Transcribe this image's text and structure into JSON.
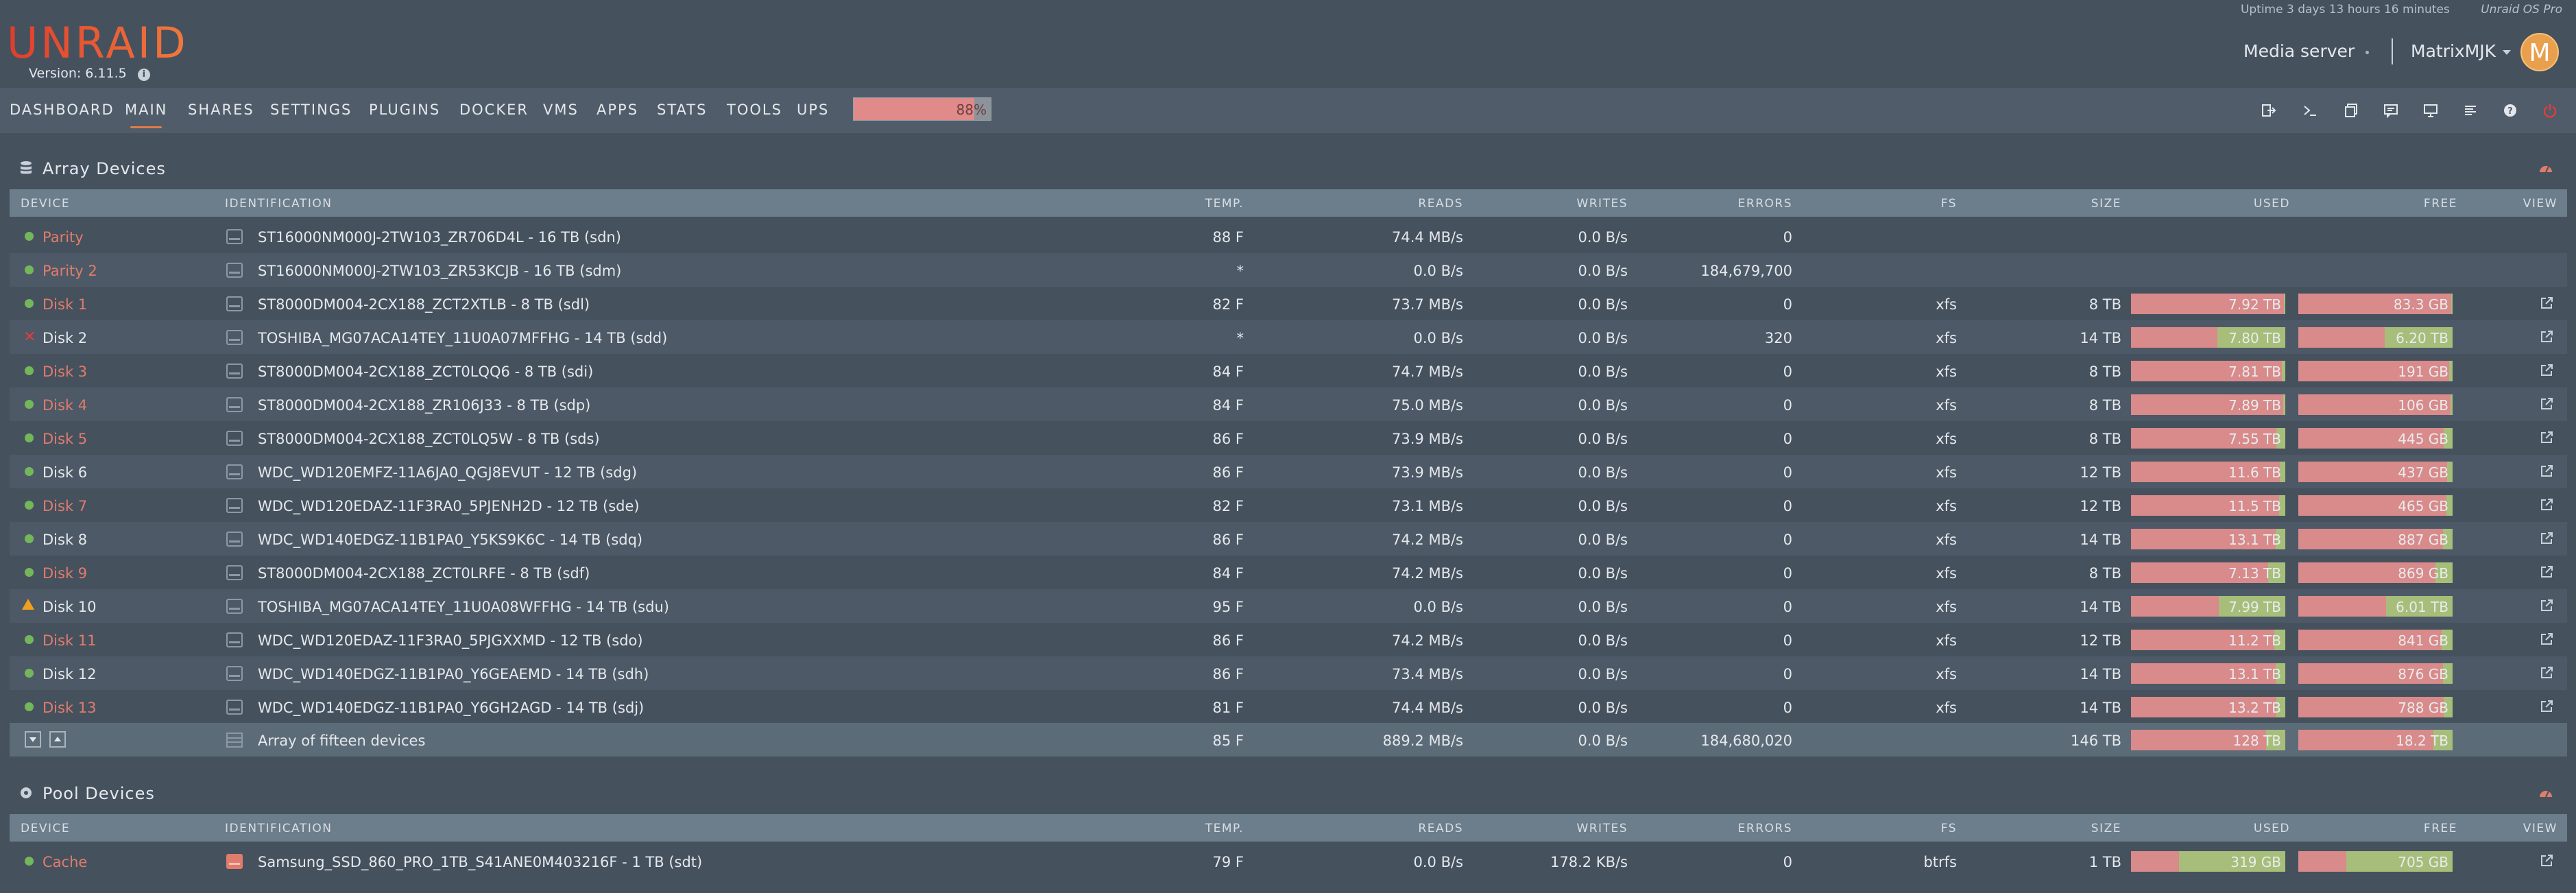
{
  "header": {
    "logo": "UNRAID",
    "version": "Version: 6.11.5",
    "uptime": "Uptime 3 days 13 hours 16 minutes",
    "os": "Unraid OS Pro",
    "server_name": "Media server",
    "user_name": "MatrixMJK",
    "avatar_letter": "M"
  },
  "nav": {
    "items": [
      "DASHBOARD",
      "MAIN",
      "SHARES",
      "SETTINGS",
      "PLUGINS",
      "DOCKER",
      "VMS",
      "APPS",
      "STATS",
      "TOOLS",
      "UPS"
    ],
    "active": "MAIN",
    "cpu_load_text": "88%",
    "cpu_load": 0.88,
    "toolbar_icons": [
      "logout-icon",
      "terminal-icon",
      "copy-icon",
      "feedback-icon",
      "monitor-icon",
      "log-icon",
      "help-icon",
      "power-icon"
    ]
  },
  "colors": {
    "accent": "#e07c48",
    "used": "#d98a8a",
    "free": "#a7be7a",
    "ok": "#73b75a",
    "error": "#e23c3c",
    "warn": "#f0a020"
  },
  "array": {
    "title": "Array Devices",
    "columns": [
      "DEVICE",
      "IDENTIFICATION",
      "TEMP.",
      "READS",
      "WRITES",
      "ERRORS",
      "FS",
      "SIZE",
      "USED",
      "FREE",
      "VIEW"
    ],
    "rows": [
      {
        "status": "ok",
        "device": "Parity",
        "color": "red",
        "ident": "ST16000NM000J-2TW103_ZR706D4L - 16 TB (sdn)",
        "temp": "88 F",
        "reads": "74.4 MB/s",
        "writes": "0.0 B/s",
        "errors": "0",
        "fs": "",
        "size": "",
        "used": "",
        "free": "",
        "used_frac": 0
      },
      {
        "status": "ok",
        "device": "Parity 2",
        "color": "red",
        "ident": "ST16000NM000J-2TW103_ZR53KCJB - 16 TB (sdm)",
        "temp": "*",
        "reads": "0.0 B/s",
        "writes": "0.0 B/s",
        "errors": "184,679,700",
        "fs": "",
        "size": "",
        "used": "",
        "free": "",
        "used_frac": 0
      },
      {
        "status": "ok",
        "device": "Disk 1",
        "color": "red",
        "ident": "ST8000DM004-2CX188_ZCT2XTLB - 8 TB (sdl)",
        "temp": "82 F",
        "reads": "73.7 MB/s",
        "writes": "0.0 B/s",
        "errors": "0",
        "fs": "xfs",
        "size": "8 TB",
        "used": "7.92 TB",
        "free": "83.3 GB",
        "used_frac": 0.99
      },
      {
        "status": "error",
        "device": "Disk 2",
        "color": "light",
        "ident": "TOSHIBA_MG07ACA14TEY_11U0A07MFFHG - 14 TB (sdd)",
        "temp": "*",
        "reads": "0.0 B/s",
        "writes": "0.0 B/s",
        "errors": "320",
        "fs": "xfs",
        "size": "14 TB",
        "used": "7.80 TB",
        "free": "6.20 TB",
        "used_frac": 0.56
      },
      {
        "status": "ok",
        "device": "Disk 3",
        "color": "red",
        "ident": "ST8000DM004-2CX188_ZCT0LQQ6 - 8 TB (sdi)",
        "temp": "84 F",
        "reads": "74.7 MB/s",
        "writes": "0.0 B/s",
        "errors": "0",
        "fs": "xfs",
        "size": "8 TB",
        "used": "7.81 TB",
        "free": "191 GB",
        "used_frac": 0.976
      },
      {
        "status": "ok",
        "device": "Disk 4",
        "color": "red",
        "ident": "ST8000DM004-2CX188_ZR106J33 - 8 TB (sdp)",
        "temp": "84 F",
        "reads": "75.0 MB/s",
        "writes": "0.0 B/s",
        "errors": "0",
        "fs": "xfs",
        "size": "8 TB",
        "used": "7.89 TB",
        "free": "106 GB",
        "used_frac": 0.987
      },
      {
        "status": "ok",
        "device": "Disk 5",
        "color": "red",
        "ident": "ST8000DM004-2CX188_ZCT0LQ5W - 8 TB (sds)",
        "temp": "86 F",
        "reads": "73.9 MB/s",
        "writes": "0.0 B/s",
        "errors": "0",
        "fs": "xfs",
        "size": "8 TB",
        "used": "7.55 TB",
        "free": "445 GB",
        "used_frac": 0.944
      },
      {
        "status": "ok",
        "device": "Disk 6",
        "color": "light",
        "ident": "WDC_WD120EMFZ-11A6JA0_QGJ8EVUT - 12 TB (sdg)",
        "temp": "86 F",
        "reads": "73.9 MB/s",
        "writes": "0.0 B/s",
        "errors": "0",
        "fs": "xfs",
        "size": "12 TB",
        "used": "11.6 TB",
        "free": "437 GB",
        "used_frac": 0.964
      },
      {
        "status": "ok",
        "device": "Disk 7",
        "color": "red",
        "ident": "WDC_WD120EDAZ-11F3RA0_5PJENH2D - 12 TB (sde)",
        "temp": "82 F",
        "reads": "73.1 MB/s",
        "writes": "0.0 B/s",
        "errors": "0",
        "fs": "xfs",
        "size": "12 TB",
        "used": "11.5 TB",
        "free": "465 GB",
        "used_frac": 0.961
      },
      {
        "status": "ok",
        "device": "Disk 8",
        "color": "light",
        "ident": "WDC_WD140EDGZ-11B1PA0_Y5KS9K6C - 14 TB (sdq)",
        "temp": "86 F",
        "reads": "74.2 MB/s",
        "writes": "0.0 B/s",
        "errors": "0",
        "fs": "xfs",
        "size": "14 TB",
        "used": "13.1 TB",
        "free": "887 GB",
        "used_frac": 0.937
      },
      {
        "status": "ok",
        "device": "Disk 9",
        "color": "red",
        "ident": "ST8000DM004-2CX188_ZCT0LRFE - 8 TB (sdf)",
        "temp": "84 F",
        "reads": "74.2 MB/s",
        "writes": "0.0 B/s",
        "errors": "0",
        "fs": "xfs",
        "size": "8 TB",
        "used": "7.13 TB",
        "free": "869 GB",
        "used_frac": 0.891
      },
      {
        "status": "warn",
        "device": "Disk 10",
        "color": "light",
        "ident": "TOSHIBA_MG07ACA14TEY_11U0A08WFFHG - 14 TB (sdu)",
        "temp": "95 F",
        "reads": "0.0 B/s",
        "writes": "0.0 B/s",
        "errors": "0",
        "fs": "xfs",
        "size": "14 TB",
        "used": "7.99 TB",
        "free": "6.01 TB",
        "used_frac": 0.571
      },
      {
        "status": "ok",
        "device": "Disk 11",
        "color": "red",
        "ident": "WDC_WD120EDAZ-11F3RA0_5PJGXXMD - 12 TB (sdo)",
        "temp": "86 F",
        "reads": "74.2 MB/s",
        "writes": "0.0 B/s",
        "errors": "0",
        "fs": "xfs",
        "size": "12 TB",
        "used": "11.2 TB",
        "free": "841 GB",
        "used_frac": 0.93
      },
      {
        "status": "ok",
        "device": "Disk 12",
        "color": "light",
        "ident": "WDC_WD140EDGZ-11B1PA0_Y6GEAEMD - 14 TB (sdh)",
        "temp": "86 F",
        "reads": "73.4 MB/s",
        "writes": "0.0 B/s",
        "errors": "0",
        "fs": "xfs",
        "size": "14 TB",
        "used": "13.1 TB",
        "free": "876 GB",
        "used_frac": 0.937
      },
      {
        "status": "ok",
        "device": "Disk 13",
        "color": "red",
        "ident": "WDC_WD140EDGZ-11B1PA0_Y6GH2AGD - 14 TB (sdj)",
        "temp": "81 F",
        "reads": "74.4 MB/s",
        "writes": "0.0 B/s",
        "errors": "0",
        "fs": "xfs",
        "size": "14 TB",
        "used": "13.2 TB",
        "free": "788 GB",
        "used_frac": 0.943
      }
    ],
    "total": {
      "ident": "Array of fifteen devices",
      "temp": "85 F",
      "reads": "889.2 MB/s",
      "writes": "0.0 B/s",
      "errors": "184,680,020",
      "size": "146 TB",
      "used": "128 TB",
      "free": "18.2 TB",
      "used_frac": 0.875
    }
  },
  "pool": {
    "title": "Pool Devices",
    "columns": [
      "DEVICE",
      "IDENTIFICATION",
      "TEMP.",
      "READS",
      "WRITES",
      "ERRORS",
      "FS",
      "SIZE",
      "USED",
      "FREE",
      "VIEW"
    ],
    "rows": [
      {
        "status": "ok",
        "device": "Cache",
        "color": "red",
        "ident": "Samsung_SSD_860_PRO_1TB_S41ANE0M403216F - 1 TB (sdt)",
        "temp": "79 F",
        "reads": "0.0 B/s",
        "writes": "178.2 KB/s",
        "errors": "0",
        "fs": "btrfs",
        "size": "1 TB",
        "used": "319 GB",
        "free": "705 GB",
        "used_frac": 0.31
      }
    ]
  }
}
